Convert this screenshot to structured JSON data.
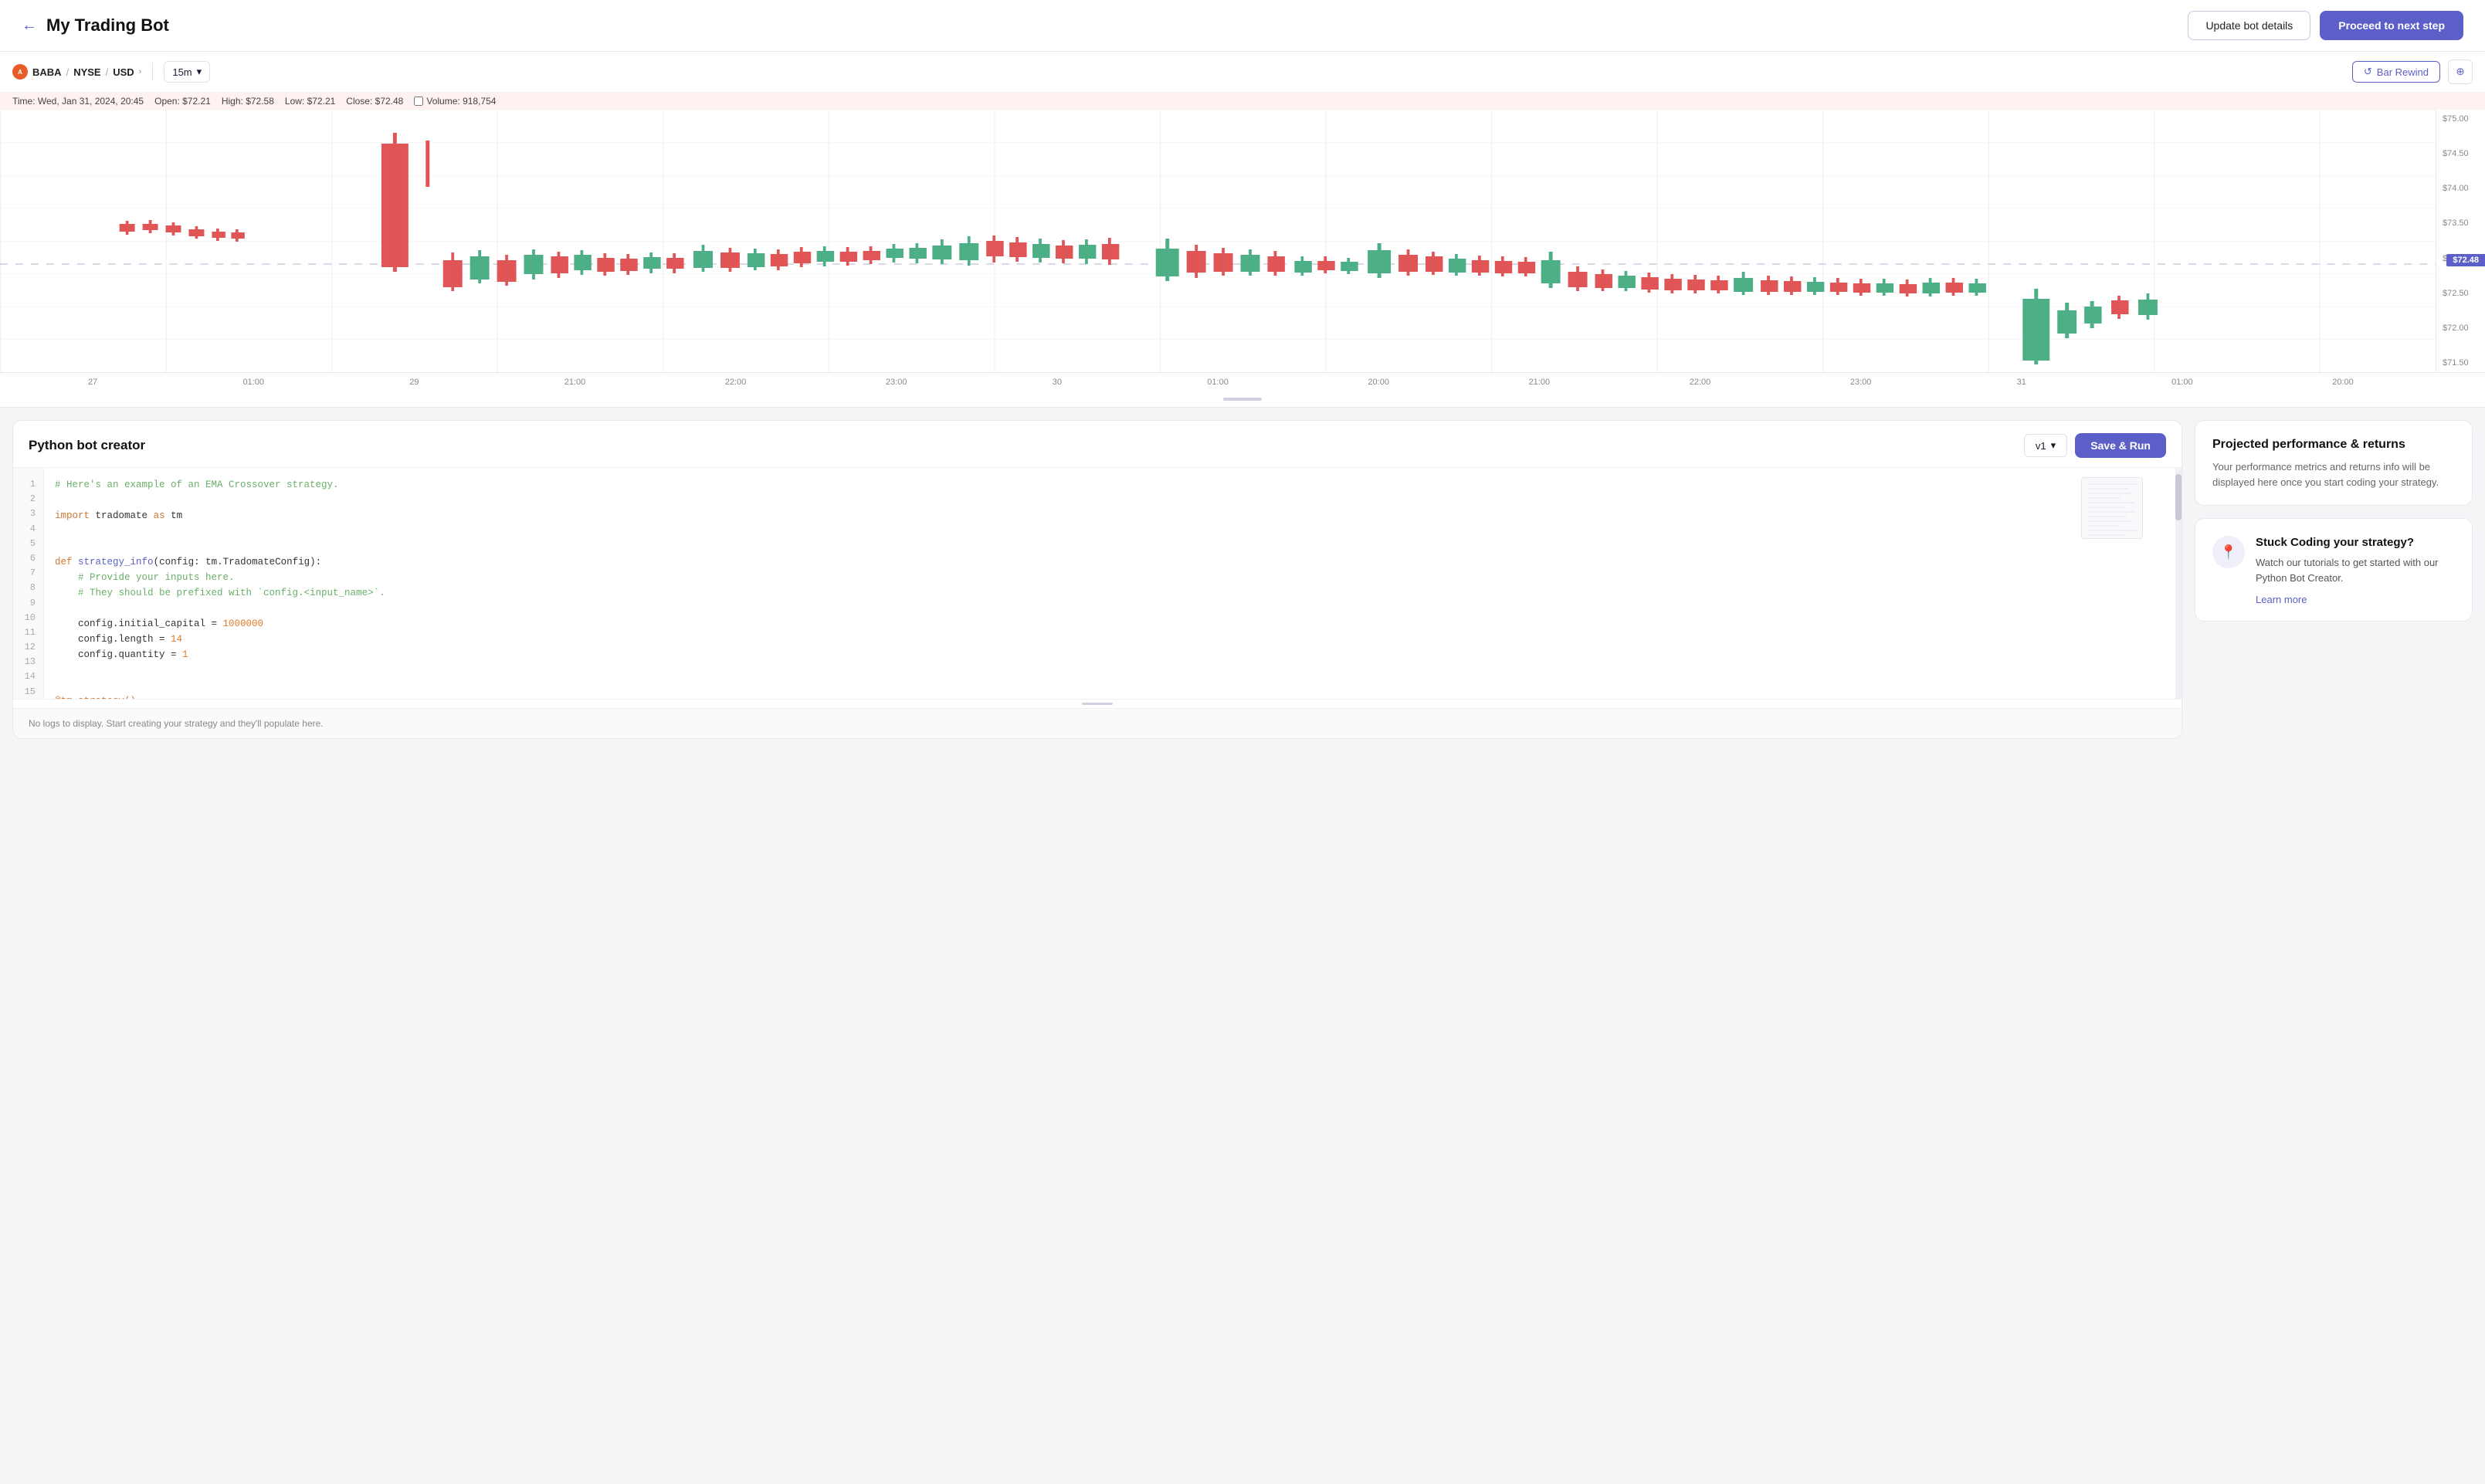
{
  "header": {
    "back_label": "←",
    "title": "My Trading Bot",
    "update_btn": "Update bot details",
    "proceed_btn": "Proceed to next step"
  },
  "chart": {
    "symbol": "BABA",
    "exchange": "NYSE",
    "currency": "USD",
    "timeframe": "15m",
    "bar_rewind": "Bar Rewind",
    "ohlcv_time": "Time: Wed, Jan 31, 2024, 20:45",
    "ohlcv_open": "Open: $72.21",
    "ohlcv_high": "High: $72.58",
    "ohlcv_low": "Low: $72.21",
    "ohlcv_close": "Close: $72.48",
    "ohlcv_volume_label": "Volume:",
    "ohlcv_volume": "918,754",
    "price_levels": [
      "$75.00",
      "$74.50",
      "$74.00",
      "$73.50",
      "$73.00",
      "$72.50",
      "$72.00",
      "$71.50"
    ],
    "current_price_badge": "$72.48",
    "time_labels": [
      "27",
      "01:00",
      "29",
      "21:00",
      "22:00",
      "23:00",
      "30",
      "01:00",
      "20:00",
      "21:00",
      "22:00",
      "23:00",
      "31",
      "01:00",
      "20:00"
    ]
  },
  "code_panel": {
    "title": "Python bot creator",
    "version": "v1",
    "save_run_btn": "Save & Run",
    "lines": [
      {
        "num": 1,
        "code": "# Here's an example of an EMA Crossover strategy.",
        "type": "comment"
      },
      {
        "num": 2,
        "code": "",
        "type": "normal"
      },
      {
        "num": 3,
        "code": "import tradomate as tm",
        "type": "normal"
      },
      {
        "num": 4,
        "code": "",
        "type": "normal"
      },
      {
        "num": 5,
        "code": "",
        "type": "normal"
      },
      {
        "num": 6,
        "code": "def strategy_info(config: tm.TradomateConfig):",
        "type": "def"
      },
      {
        "num": 7,
        "code": "    # Provide your inputs here.",
        "type": "comment"
      },
      {
        "num": 8,
        "code": "    # They should be prefixed with `config.<input_name>`.",
        "type": "comment"
      },
      {
        "num": 9,
        "code": "",
        "type": "normal"
      },
      {
        "num": 10,
        "code": "    config.initial_capital = 1000000",
        "type": "code"
      },
      {
        "num": 11,
        "code": "    config.length = 14",
        "type": "code"
      },
      {
        "num": 12,
        "code": "    config.quantity = 1",
        "type": "code"
      },
      {
        "num": 13,
        "code": "",
        "type": "normal"
      },
      {
        "num": 14,
        "code": "",
        "type": "normal"
      },
      {
        "num": 15,
        "code": "@tm.strategy()",
        "type": "decorator"
      }
    ],
    "logs_placeholder": "No logs to display. Start creating your strategy and they'll populate here."
  },
  "performance_card": {
    "title": "Projected performance & returns",
    "description": "Your performance metrics and returns info will be displayed here once you start coding your strategy."
  },
  "stuck_card": {
    "title": "Stuck Coding your strategy?",
    "description": "Watch our tutorials to get started with our Python Bot Creator.",
    "learn_more": "Learn more"
  }
}
